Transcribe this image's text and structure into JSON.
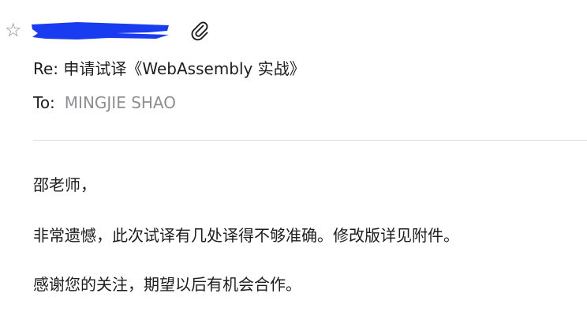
{
  "header": {
    "star_glyph": "☆",
    "sender": "",
    "redaction_color": "#1a3cf0",
    "attachment_icon": "paperclip-icon"
  },
  "subject": "Re: 申请试译《WebAssembly 实战》",
  "recipient": {
    "label": "To:",
    "name": "MINGJIE SHAO"
  },
  "body": {
    "greeting": "邵老师，",
    "paragraph1": "非常遗憾，此次试译有几处译得不够准确。修改版详见附件。",
    "paragraph2": "感谢您的关注，期望以后有机会合作。"
  }
}
